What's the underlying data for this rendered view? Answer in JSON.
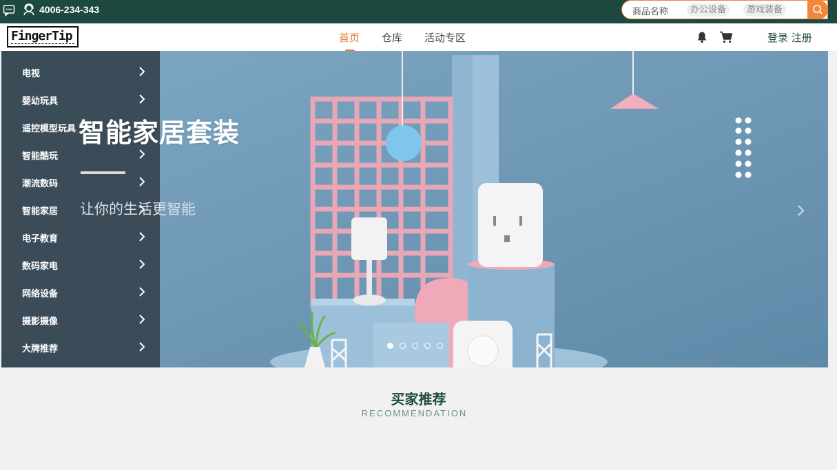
{
  "topbar": {
    "phone": "4006-234-343",
    "search": {
      "placeholder": "商品名称",
      "chips": [
        "办公设备",
        "游戏装备"
      ]
    }
  },
  "nav": {
    "logo_text": "FingerTip",
    "links": [
      "首页",
      "仓库",
      "活动专区"
    ],
    "active_link": "首页",
    "login": "登录",
    "register": "注册"
  },
  "sidebar": {
    "items": [
      "电视",
      "婴幼玩具",
      "遥控模型玩具",
      "智能酷玩",
      "潮流数码",
      "智能家居",
      "电子教育",
      "数码家电",
      "网络设备",
      "摄影摄像",
      "大牌推荐"
    ]
  },
  "banner": {
    "title": "智能家居套装",
    "subtitle": "让你的生活更智能",
    "active_slide": 1,
    "slide_count": 5
  },
  "recommendation": {
    "title": "买家推荐",
    "subtitle": "RECOMMENDATION"
  },
  "colors": {
    "brand_dark": "#1d4941",
    "accent": "#e8782b",
    "banner_bg": "#6e98b6"
  }
}
